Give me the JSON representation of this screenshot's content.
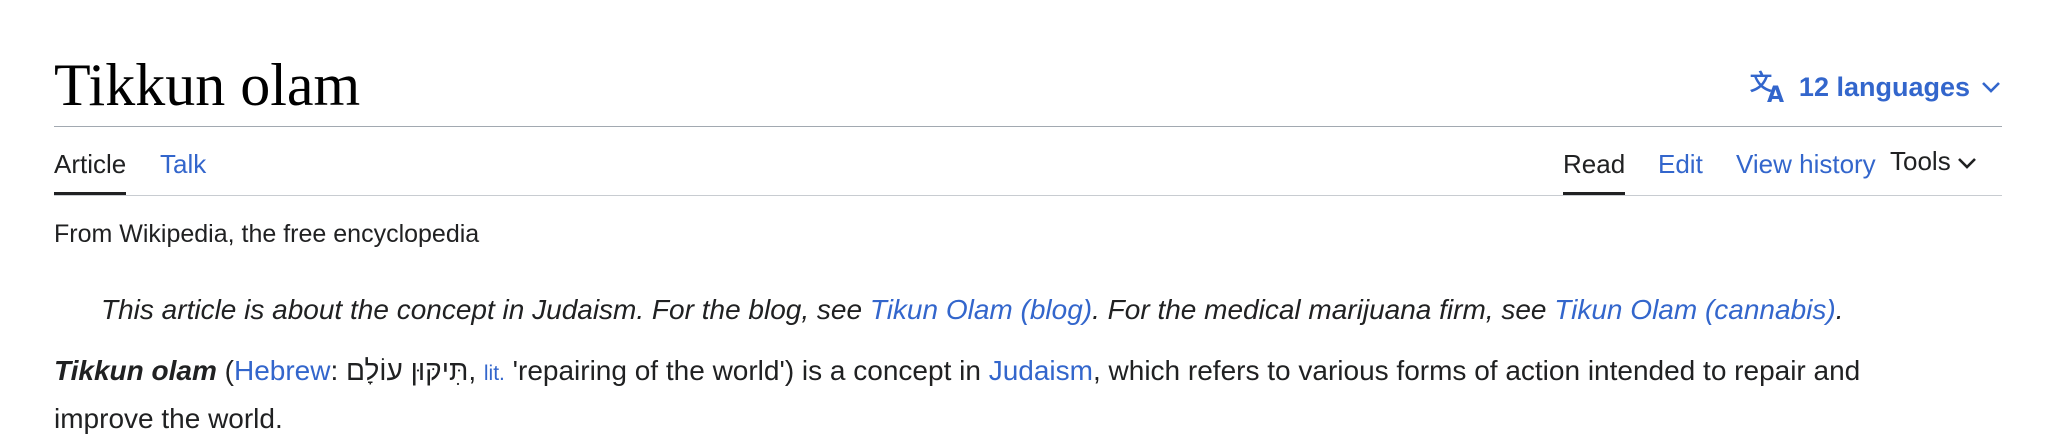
{
  "header": {
    "title": "Tikkun olam",
    "languages_label": "12 languages"
  },
  "tabs": {
    "left": [
      {
        "label": "Article",
        "selected": true
      },
      {
        "label": "Talk",
        "selected": false
      }
    ],
    "right": [
      {
        "label": "Read",
        "selected": true
      },
      {
        "label": "Edit",
        "selected": false
      },
      {
        "label": "View history",
        "selected": false
      },
      {
        "label": "Tools",
        "selected": false
      }
    ]
  },
  "tagline": "From Wikipedia, the free encyclopedia",
  "hatnote": {
    "p1": "This article is about the concept in Judaism. For the blog, see ",
    "link1": "Tikun Olam (blog)",
    "p2": ". For the medical marijuana firm, see ",
    "link2": "Tikun Olam (cannabis)",
    "p3": "."
  },
  "lead": {
    "term": "Tikkun olam",
    "open_paren": " (",
    "hebrew_link": "Hebrew",
    "colon": ": ",
    "hebrew_text": "תִּיקּוּן עוֹלָם",
    "comma": ", ",
    "lit_abbr": "lit.",
    "translation": " 'repairing of the world') is a concept in ",
    "judaism_link": "Judaism",
    "rest": ", which refers to various forms of action intended to repair and improve the world."
  },
  "colors": {
    "link": "#3366cc",
    "text": "#202122",
    "border": "#a2a9b1"
  },
  "icons": {
    "language": "translate-icon",
    "dropdown": "chevron-down-icon"
  }
}
